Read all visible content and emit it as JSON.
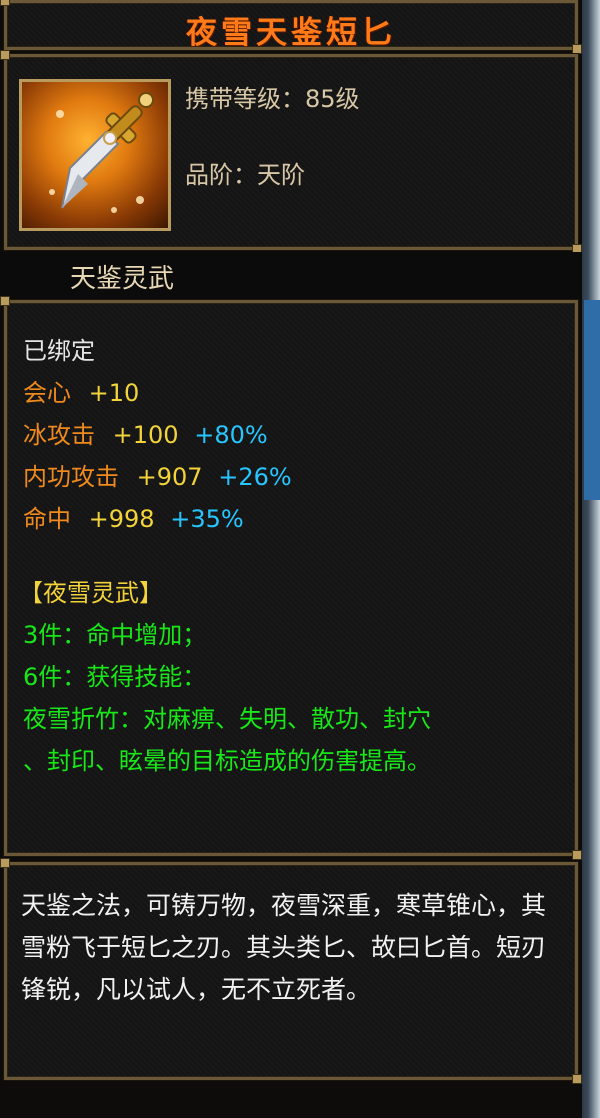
{
  "item": {
    "name": "夜雪天鉴短匕",
    "icon": "dagger-icon",
    "level_label": "携带等级：",
    "level_value": "85级",
    "grade_label": "品阶：",
    "grade_value": "天阶",
    "subtitle": "天鉴灵武"
  },
  "stats": {
    "bound": "已绑定",
    "rows": [
      {
        "name": "会心",
        "base": "+10",
        "pct": ""
      },
      {
        "name": "冰攻击",
        "base": "+100",
        "pct": "+80%"
      },
      {
        "name": "内功攻击",
        "base": "+907",
        "pct": "+26%"
      },
      {
        "name": "命中",
        "base": "+998",
        "pct": "+35%"
      }
    ]
  },
  "set_bonus": {
    "title": "【夜雪灵武】",
    "lines": [
      "3件：命中增加；",
      "6件：获得技能：",
      "夜雪折竹：对麻痹、失明、散功、封穴",
      "、封印、眩晕的目标造成的伤害提高。"
    ]
  },
  "description": "天鉴之法，可铸万物，夜雪深重，寒草锥心，其雪粉飞于短匕之刃。其头类匕、故曰匕首。短刃锋锐，凡以试人，无不立死者。",
  "colors": {
    "title": "#ff7a18",
    "stat_name": "#f08a1c",
    "stat_value": "#f2d33a",
    "stat_percent": "#27c6ff",
    "set_text": "#18e818",
    "frame": "#6b5836"
  }
}
